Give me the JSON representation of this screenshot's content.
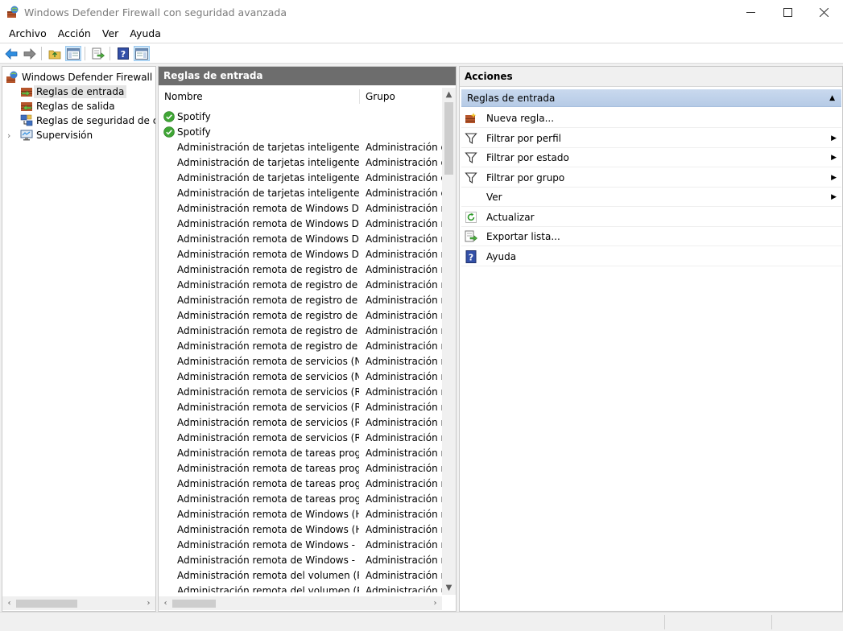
{
  "window": {
    "title": "Windows Defender Firewall con seguridad avanzada",
    "icons": [
      "firewall-icon",
      "minimize-icon",
      "maximize-icon",
      "close-icon"
    ]
  },
  "menu": [
    "Archivo",
    "Acción",
    "Ver",
    "Ayuda"
  ],
  "toolbar": {
    "buttons": [
      "back-icon",
      "forward-icon",
      "up-folder-icon",
      "show-hide-tree-icon",
      "export-icon",
      "help-icon",
      "show-hide-action-icon"
    ]
  },
  "tree": {
    "root": "Windows Defender Firewall con",
    "items": [
      {
        "label": "Reglas de entrada",
        "selected": true
      },
      {
        "label": "Reglas de salida"
      },
      {
        "label": "Reglas de seguridad de con"
      },
      {
        "label": "Supervisión"
      }
    ]
  },
  "list": {
    "header": "Reglas de entrada",
    "columns": {
      "name": "Nombre",
      "group": "Grupo"
    },
    "rows": [
      {
        "name": "Spotify",
        "group": "",
        "enabled": true
      },
      {
        "name": "Spotify",
        "group": "",
        "enabled": true
      },
      {
        "name": "Administración de tarjetas inteligentes vi...",
        "group": "Administración de"
      },
      {
        "name": "Administración de tarjetas inteligentes vi...",
        "group": "Administración de"
      },
      {
        "name": "Administración de tarjetas inteligentes vi...",
        "group": "Administración de"
      },
      {
        "name": "Administración de tarjetas inteligentes vi...",
        "group": "Administración de"
      },
      {
        "name": "Administración remota de Windows Defe...",
        "group": "Administración re"
      },
      {
        "name": "Administración remota de Windows Defe...",
        "group": "Administración re"
      },
      {
        "name": "Administración remota de Windows Defe...",
        "group": "Administración re"
      },
      {
        "name": "Administración remota de Windows Defe...",
        "group": "Administración re"
      },
      {
        "name": "Administración remota de registro de ev...",
        "group": "Administración re"
      },
      {
        "name": "Administración remota de registro de ev...",
        "group": "Administración re"
      },
      {
        "name": "Administración remota de registro de ev...",
        "group": "Administración re"
      },
      {
        "name": "Administración remota de registro de ev...",
        "group": "Administración re"
      },
      {
        "name": "Administración remota de registro de ev...",
        "group": "Administración re"
      },
      {
        "name": "Administración remota de registro de ev...",
        "group": "Administración re"
      },
      {
        "name": "Administración remota de servicios (NP ...",
        "group": "Administración re"
      },
      {
        "name": "Administración remota de servicios (NP ...",
        "group": "Administración re"
      },
      {
        "name": "Administración remota de servicios (RPC)",
        "group": "Administración re"
      },
      {
        "name": "Administración remota de servicios (RPC)",
        "group": "Administración re"
      },
      {
        "name": "Administración remota de servicios (RPC...",
        "group": "Administración re"
      },
      {
        "name": "Administración remota de servicios (RPC...",
        "group": "Administración re"
      },
      {
        "name": "Administración remota de tareas progra...",
        "group": "Administración re"
      },
      {
        "name": "Administración remota de tareas progra...",
        "group": "Administración re"
      },
      {
        "name": "Administración remota de tareas progra...",
        "group": "Administración re"
      },
      {
        "name": "Administración remota de tareas progra...",
        "group": "Administración re"
      },
      {
        "name": "Administración remota de Windows (HT...",
        "group": "Administración re"
      },
      {
        "name": "Administración remota de Windows (HT...",
        "group": "Administración re"
      },
      {
        "name": "Administración remota de Windows - M...",
        "group": "Administración re"
      },
      {
        "name": "Administración remota de Windows - M...",
        "group": "Administración re"
      },
      {
        "name": "Administración remota del volumen (RC...",
        "group": "Administración re"
      },
      {
        "name": "Administración remota del volumen (RC...",
        "group": "Administración re"
      }
    ]
  },
  "actions": {
    "header": "Acciones",
    "section": "Reglas de entrada",
    "items": [
      {
        "label": "Nueva regla...",
        "icon": "new-rule-icon",
        "submenu": false
      },
      {
        "label": "Filtrar por perfil",
        "icon": "filter-icon",
        "submenu": true
      },
      {
        "label": "Filtrar por estado",
        "icon": "filter-icon",
        "submenu": true
      },
      {
        "label": "Filtrar por grupo",
        "icon": "filter-icon",
        "submenu": true
      },
      {
        "label": "Ver",
        "icon": "",
        "submenu": true
      },
      {
        "label": "Actualizar",
        "icon": "refresh-icon",
        "submenu": false
      },
      {
        "label": "Exportar lista...",
        "icon": "export-icon",
        "submenu": false
      },
      {
        "label": "Ayuda",
        "icon": "help-icon",
        "submenu": false
      }
    ]
  }
}
